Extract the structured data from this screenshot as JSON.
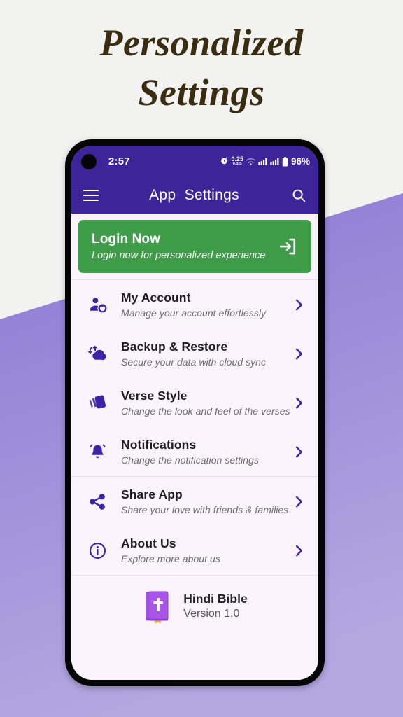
{
  "page": {
    "headline_line1": "Personalized",
    "headline_line2": "Settings",
    "bg_color": "#f2f2f1",
    "accent_purple": "#8d7bd5",
    "brand_purple": "#3d2499",
    "screen_bg": "#fbf4fd"
  },
  "statusbar": {
    "time": "2:57",
    "alarm_icon": "alarm-icon",
    "net_speed_value": "0.25",
    "net_speed_unit": "KB/S",
    "wifi_icon": "wifi-icon",
    "signal_icon_1": "signal-bars-icon",
    "signal_icon_2": "signal-bars-icon",
    "battery_icon": "battery-icon",
    "battery_label": "96%"
  },
  "appbar": {
    "menu_icon": "hamburger-menu-icon",
    "title": "App  Settings",
    "search_icon": "search-icon"
  },
  "login_card": {
    "title": "Login Now",
    "subtitle": "Login now for personalized experience",
    "icon": "login-arrow-icon",
    "bg_color": "#3f9c48"
  },
  "settings_groups": [
    {
      "items": [
        {
          "icon": "account-gear-icon",
          "title": "My Account",
          "subtitle": "Manage your account effortlessly",
          "chevron": "chevron-right-icon"
        },
        {
          "icon": "cloud-sync-icon",
          "title": "Backup & Restore",
          "subtitle": "Secure your data with cloud sync",
          "chevron": "chevron-right-icon"
        },
        {
          "icon": "verse-style-cards-icon",
          "title": "Verse Style",
          "subtitle": "Change the look and feel of the verses",
          "chevron": "chevron-right-icon"
        },
        {
          "icon": "bell-icon",
          "title": "Notifications",
          "subtitle": "Change the notification settings",
          "chevron": "chevron-right-icon"
        }
      ]
    },
    {
      "items": [
        {
          "icon": "share-nodes-icon",
          "title": "Share App",
          "subtitle": "Share your love with friends & families",
          "chevron": "chevron-right-icon"
        },
        {
          "icon": "info-circle-icon",
          "title": "About Us",
          "subtitle": "Explore more about us",
          "chevron": "chevron-right-icon"
        }
      ]
    }
  ],
  "footer": {
    "app_icon": "bible-book-icon",
    "app_name": "Hindi Bible",
    "version": "Version 1.0"
  }
}
